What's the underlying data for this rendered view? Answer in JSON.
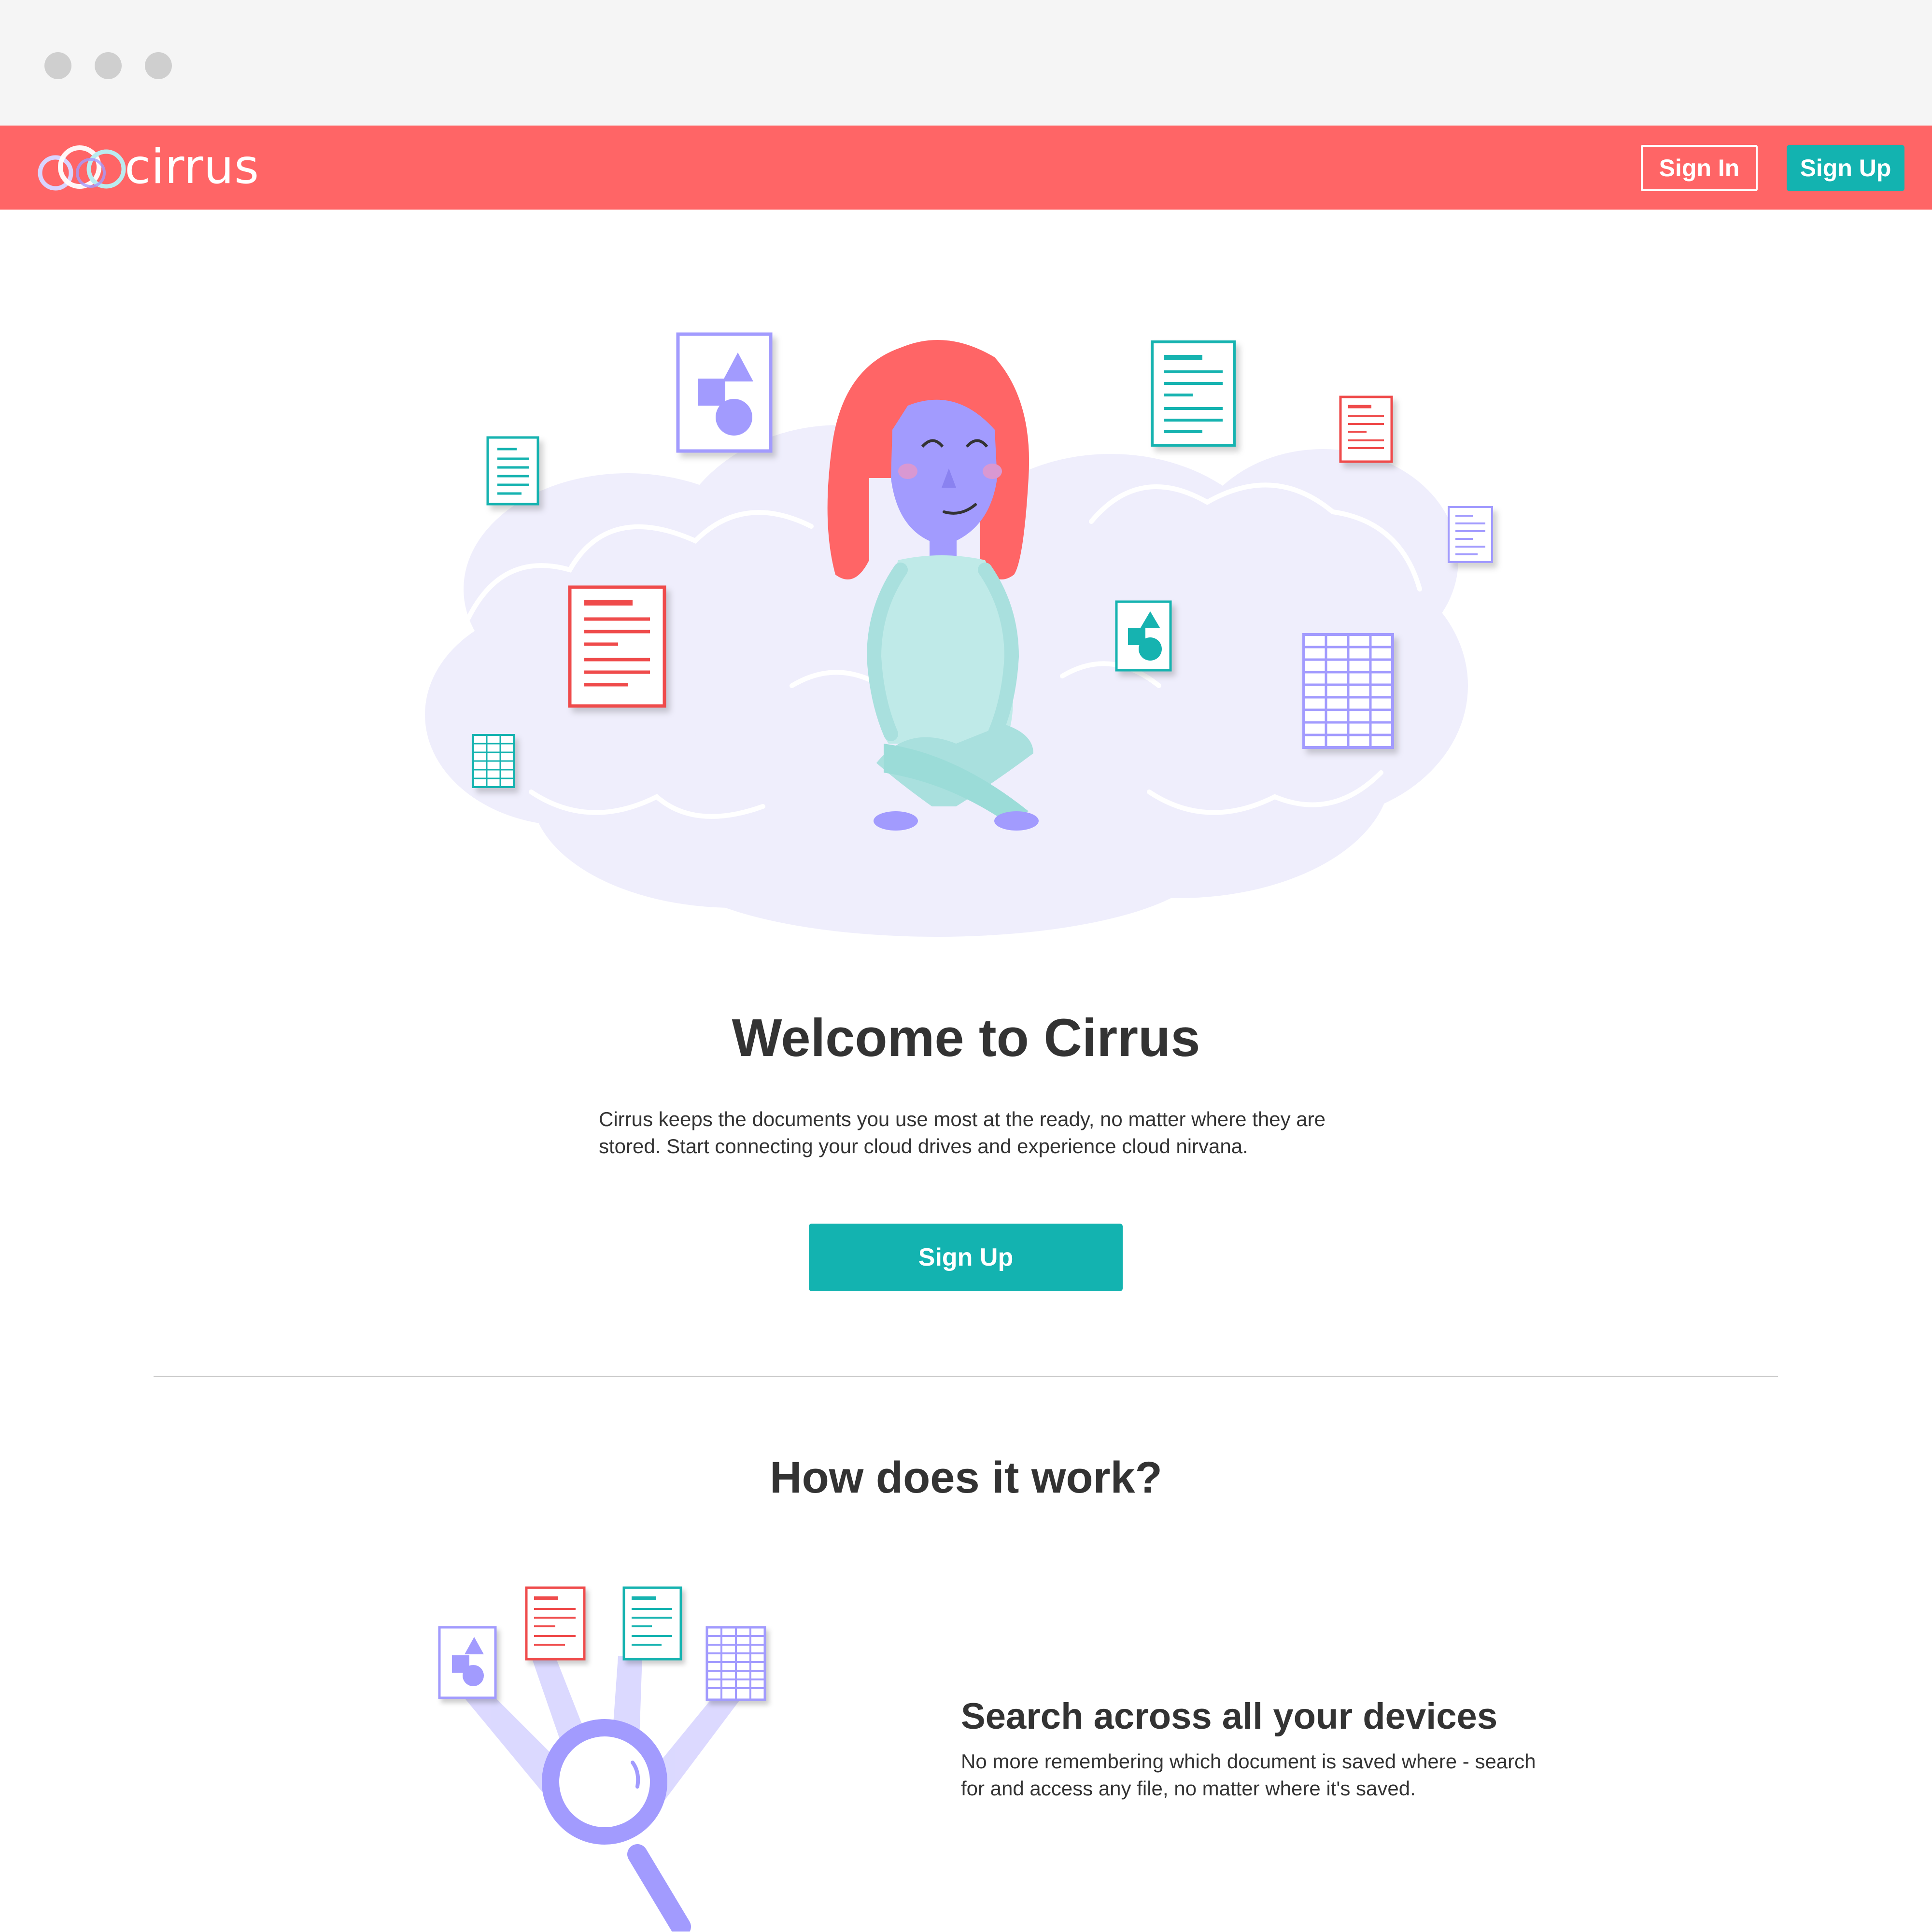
{
  "window": {
    "controls": [
      "close",
      "minimize",
      "maximize"
    ]
  },
  "header": {
    "brand": "cirrus",
    "logo_icon": "cirrus-rings-logo-icon",
    "sign_in_label": "Sign In",
    "sign_up_label": "Sign Up"
  },
  "hero": {
    "illustration": "woman-meditating-on-cloud-with-documents",
    "title": "Welcome to Cirrus",
    "description": "Cirrus keeps the documents you use most at the ready, no matter where they are stored. Start connecting your cloud drives and experience cloud nirvana.",
    "cta_label": "Sign Up"
  },
  "how_it_works": {
    "heading": "How does it work?",
    "features": [
      {
        "icon": "magnifier-with-documents-icon",
        "title": "Search across all your devices",
        "text": "No more remembering which document is saved where - search for and access any file, no matter where it's saved."
      }
    ]
  },
  "colors": {
    "brand_coral": "#ff6566",
    "accent_teal": "#13b3b0",
    "accent_purple": "#a29bfe",
    "cloud_lavender": "#efeefc",
    "text_dark": "#333333"
  }
}
